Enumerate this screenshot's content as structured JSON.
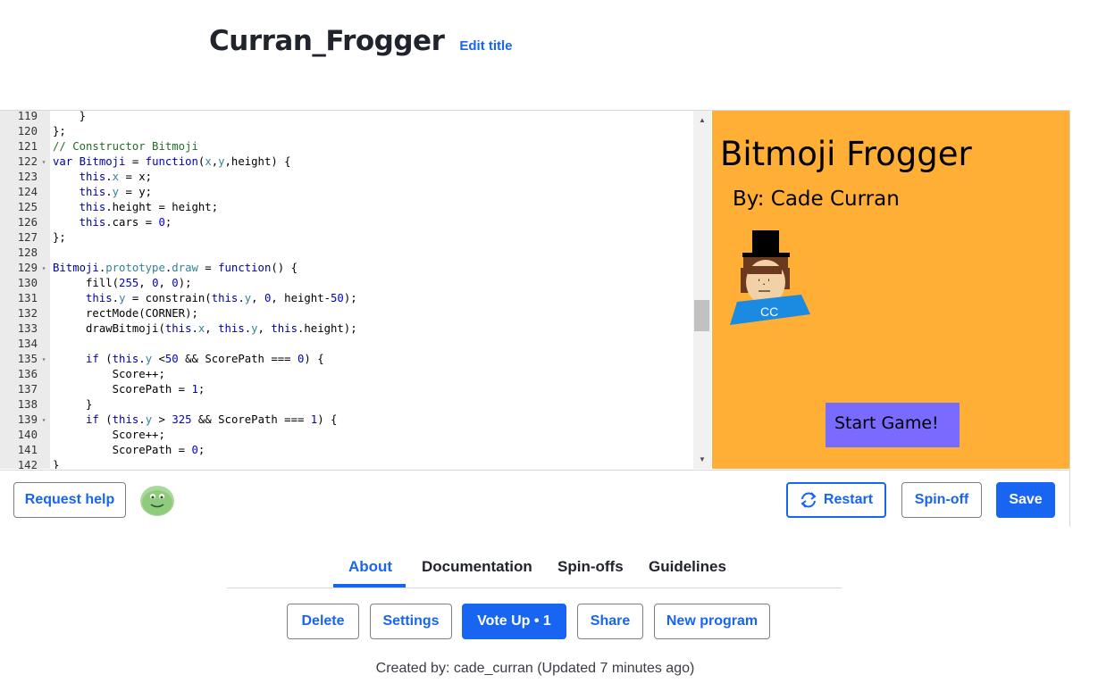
{
  "program": {
    "title": "Curran_Frogger",
    "edit_title_label": "Edit title"
  },
  "editor": {
    "lines": [
      {
        "n": "119",
        "fold": "",
        "html": "    }"
      },
      {
        "n": "120",
        "fold": "",
        "html": "};"
      },
      {
        "n": "121",
        "fold": "",
        "html": "<span class=\"cm\">// Constructor Bitmoji</span>"
      },
      {
        "n": "122",
        "fold": "▾",
        "html": "<span class=\"kw\">var</span> <span class=\"kw\">Bitmoji</span> = <span class=\"kw\">function</span>(<span class=\"mem\">x</span>,<span class=\"mem\">y</span>,height) {"
      },
      {
        "n": "123",
        "fold": "",
        "html": "    <span class=\"kw\">this</span>.<span class=\"mem\">x</span> = x;"
      },
      {
        "n": "124",
        "fold": "",
        "html": "    <span class=\"kw\">this</span>.<span class=\"mem\">y</span> = y;"
      },
      {
        "n": "125",
        "fold": "",
        "html": "    <span class=\"kw\">this</span>.height = height;"
      },
      {
        "n": "126",
        "fold": "",
        "html": "    <span class=\"kw\">this</span>.cars = <span class=\"num\">0</span>;"
      },
      {
        "n": "127",
        "fold": "",
        "html": "};"
      },
      {
        "n": "128",
        "fold": "",
        "html": ""
      },
      {
        "n": "129",
        "fold": "▾",
        "html": "<span class=\"kw\">Bitmoji</span>.<span class=\"mem\">prototype</span>.<span class=\"mem\">draw</span> = <span class=\"kw\">function</span>() {"
      },
      {
        "n": "130",
        "fold": "",
        "html": "     fill(<span class=\"num\">255</span>, <span class=\"num\">0</span>, <span class=\"num\">0</span>);"
      },
      {
        "n": "131",
        "fold": "",
        "html": "     <span class=\"kw\">this</span>.<span class=\"mem\">y</span> = constrain(<span class=\"kw\">this</span>.<span class=\"mem\">y</span>, <span class=\"num\">0</span>, height-<span class=\"num\">50</span>);"
      },
      {
        "n": "132",
        "fold": "",
        "html": "     rectMode(CORNER);"
      },
      {
        "n": "133",
        "fold": "",
        "html": "     drawBitmoji(<span class=\"kw\">this</span>.<span class=\"mem\">x</span>, <span class=\"kw\">this</span>.<span class=\"mem\">y</span>, <span class=\"kw\">this</span>.height);"
      },
      {
        "n": "134",
        "fold": "",
        "html": ""
      },
      {
        "n": "135",
        "fold": "▾",
        "html": "     <span class=\"kw\">if</span> (<span class=\"kw\">this</span>.<span class=\"mem\">y</span> &lt;<span class=\"num\">50</span> &amp;&amp; ScorePath === <span class=\"num\">0</span>) {"
      },
      {
        "n": "136",
        "fold": "",
        "html": "         Score++;"
      },
      {
        "n": "137",
        "fold": "",
        "html": "         ScorePath = <span class=\"num\">1</span>;"
      },
      {
        "n": "138",
        "fold": "",
        "html": "     }"
      },
      {
        "n": "139",
        "fold": "▾",
        "html": "     <span class=\"kw\">if</span> (<span class=\"kw\">this</span>.<span class=\"mem\">y</span> &gt; <span class=\"num\">325</span> &amp;&amp; ScorePath === <span class=\"num\">1</span>) {"
      },
      {
        "n": "140",
        "fold": "",
        "html": "         Score++;"
      },
      {
        "n": "141",
        "fold": "",
        "html": "         ScorePath = <span class=\"num\">0</span>;"
      },
      {
        "n": "142",
        "fold": "",
        "html": "}"
      }
    ]
  },
  "canvas": {
    "game_title": "Bitmoji Frogger",
    "byline": "By: Cade Curran",
    "bitmoji_initials": "CC",
    "start_button_label": "Start Game!",
    "background_color": "#ffae36"
  },
  "toolbar": {
    "request_help_label": "Request help",
    "restart_label": "Restart",
    "spinoff_label": "Spin-off",
    "save_label": "Save"
  },
  "tabs": [
    {
      "label": "About",
      "active": true
    },
    {
      "label": "Documentation",
      "active": false
    },
    {
      "label": "Spin-offs",
      "active": false
    },
    {
      "label": "Guidelines",
      "active": false
    }
  ],
  "actions": {
    "delete_label": "Delete",
    "settings_label": "Settings",
    "vote_up_label": "Vote Up • 1",
    "share_label": "Share",
    "new_program_label": "New program"
  },
  "footer": {
    "created_by": "Created by: cade_curran (Updated 7 minutes ago)"
  },
  "colors": {
    "accent": "#1865f2",
    "canvas_bg": "#ffae36",
    "start_button": "#7a6bff"
  }
}
